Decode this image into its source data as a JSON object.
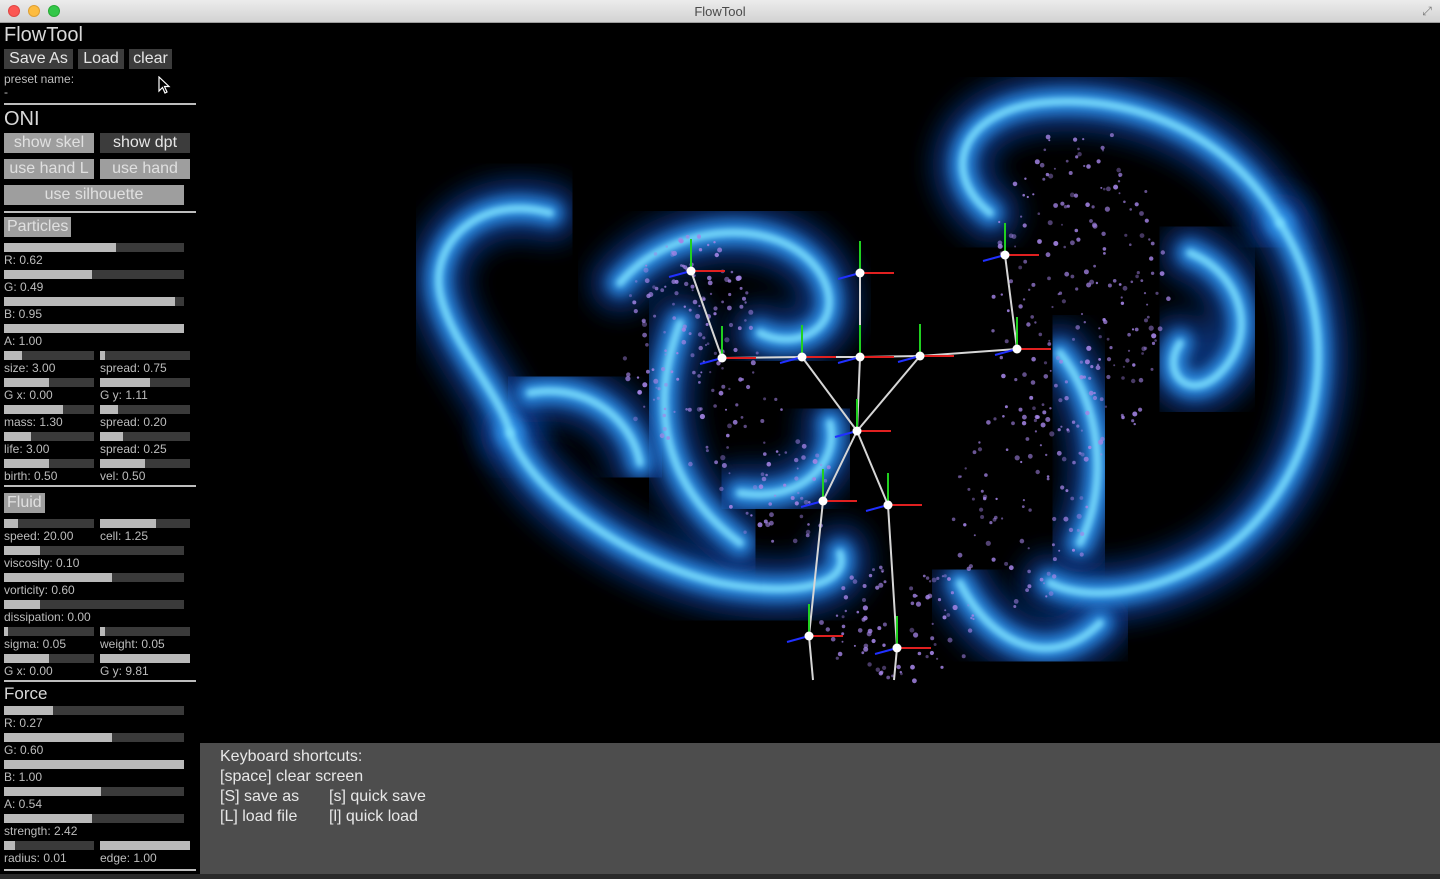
{
  "window": {
    "title": "FlowTool",
    "close_icon": "close-icon",
    "minimize_icon": "minimize-icon",
    "zoom_icon": "zoom-icon",
    "fullscreen_icon": "fullscreen-icon",
    "fullscreen_glyph": "⤢"
  },
  "panel": {
    "title": "FlowTool",
    "save_as": "Save As",
    "load": "Load",
    "clear": "clear",
    "preset_label": "preset name:",
    "preset_value": "-"
  },
  "oni": {
    "title": "ONI",
    "show_skel": "show skel",
    "show_dpt": "show dpt",
    "use_hand_l": "use hand L",
    "use_hand": "use hand",
    "use_silhouette": "use silhouette",
    "states": {
      "show_skel": true,
      "show_dpt": false,
      "use_hand_l": true,
      "use_hand": true,
      "use_silhouette": true
    }
  },
  "particles": {
    "title": "Particles",
    "sliders": [
      {
        "label": "R: 0.62",
        "value": 0.62
      },
      {
        "label": "G: 0.49",
        "value": 0.49
      },
      {
        "label": "B: 0.95",
        "value": 0.95
      },
      {
        "label": "A: 1.00",
        "value": 1.0
      }
    ],
    "pairs": [
      [
        {
          "label": "size: 3.00",
          "value": 0.2
        },
        {
          "label": "spread: 0.75",
          "value": 0.06
        }
      ],
      [
        {
          "label": "G x: 0.00",
          "value": 0.5
        },
        {
          "label": "G y: 1.11",
          "value": 0.55
        }
      ],
      [
        {
          "label": "mass: 1.30",
          "value": 0.65
        },
        {
          "label": "spread: 0.20",
          "value": 0.2
        }
      ],
      [
        {
          "label": "life: 3.00",
          "value": 0.3
        },
        {
          "label": "spread: 0.25",
          "value": 0.25
        }
      ],
      [
        {
          "label": "birth: 0.50",
          "value": 0.5
        },
        {
          "label": "vel: 0.50",
          "value": 0.5
        }
      ]
    ]
  },
  "fluid": {
    "title": "Fluid",
    "pair_top": [
      {
        "label": "speed: 20.00",
        "value": 0.15
      },
      {
        "label": "cell: 1.25",
        "value": 0.62
      }
    ],
    "sliders": [
      {
        "label": "viscosity: 0.10",
        "value": 0.2
      },
      {
        "label": "vorticity: 0.60",
        "value": 0.6
      },
      {
        "label": "dissipation: 0.00",
        "value": 0.2
      }
    ],
    "pairs": [
      [
        {
          "label": "sigma: 0.05",
          "value": 0.04
        },
        {
          "label": "weight: 0.05",
          "value": 0.05
        }
      ],
      [
        {
          "label": "G x: 0.00",
          "value": 0.5
        },
        {
          "label": "G y: 9.81",
          "value": 1.0
        }
      ]
    ]
  },
  "force": {
    "title": "Force",
    "sliders": [
      {
        "label": "R: 0.27",
        "value": 0.27
      },
      {
        "label": "G: 0.60",
        "value": 0.6
      },
      {
        "label": "B: 1.00",
        "value": 1.0
      },
      {
        "label": "A: 0.54",
        "value": 0.54
      },
      {
        "label": "strength: 2.42",
        "value": 0.49
      }
    ],
    "pair": [
      {
        "label": "radius: 0.01",
        "value": 0.12
      },
      {
        "label": "edge: 1.00",
        "value": 1.0
      }
    ]
  },
  "shortcuts": {
    "title": "Keyboard shortcuts:",
    "space": "[space] clear screen",
    "save_as": "[S] save as",
    "quick_save": "[s] quick save",
    "load_file": "[L] load file",
    "quick_load": "[l] quick load"
  },
  "colors": {
    "fluid_light": "#7fe3ff",
    "fluid_mid": "#2f8fe6",
    "fluid_dark": "#0b3a8a",
    "particles": "#a484e6",
    "bone": "#d6d6d6",
    "axis_red": "#e02020",
    "axis_green": "#20d020",
    "axis_blue": "#2030ff"
  }
}
